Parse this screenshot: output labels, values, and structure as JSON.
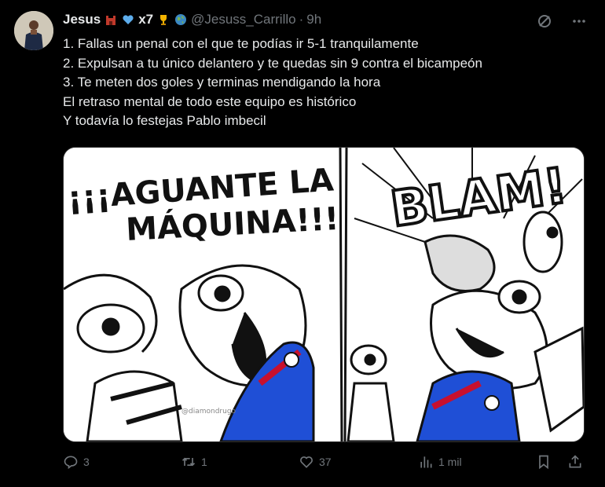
{
  "author": {
    "name": "Jesus",
    "badges": [
      "castle-emoji",
      "blue-heart-emoji"
    ],
    "badge_text": "x7",
    "badge_icons": [
      "trophy-emoji",
      "globe-emoji"
    ],
    "handle": "@Jesuss_Carrillo",
    "separator": "·",
    "time": "9h"
  },
  "tweet": {
    "lines": [
      "1. Fallas un penal con el que te podías ir 5-1 tranquilamente",
      "2. Expulsan a tu único delantero y te quedas sin 9 contra el bicampeón",
      "3. Te meten dos goles y terminas mendigando la hora",
      "El retraso mental de todo este equipo es histórico",
      "Y todavía lo festejas Pablo imbecil"
    ]
  },
  "image": {
    "left_caption_1": "¡¡¡AGUANTE LA",
    "left_caption_2": "MÁQUINA!!!",
    "right_caption": "BLAM!",
    "watermark": "@diamondrugo"
  },
  "actions": {
    "replies": "3",
    "reposts": "1",
    "likes": "37",
    "views": "1 mil"
  },
  "colors": {
    "accent": "#1d9bf0",
    "muted": "#71767b",
    "text": "#e7e9ea",
    "jersey_blue": "#1f4fd6",
    "jersey_red": "#c8102e"
  }
}
